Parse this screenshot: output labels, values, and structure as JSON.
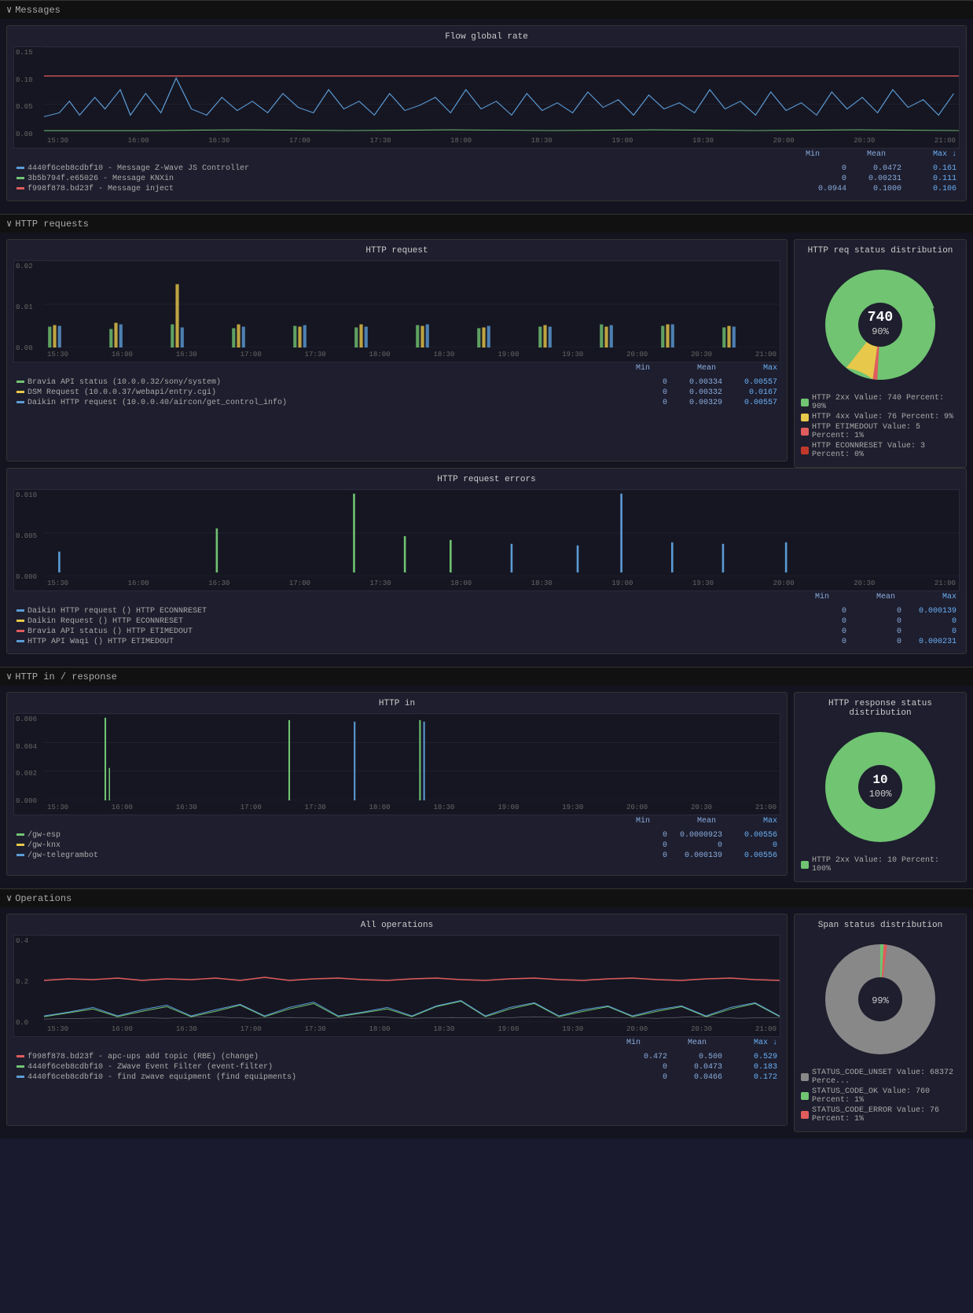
{
  "sections": {
    "messages": {
      "label": "Messages",
      "charts": {
        "flow_global_rate": {
          "title": "Flow global rate",
          "y_labels": [
            "0.15",
            "0.10",
            "0.05",
            "0.00"
          ],
          "x_labels": [
            "15:30",
            "16:00",
            "16:30",
            "17:00",
            "17:30",
            "18:00",
            "18:30",
            "19:00",
            "19:30",
            "20:00",
            "20:30",
            "21:00"
          ],
          "col_headers": [
            "Min",
            "Mean",
            "Max ↓"
          ],
          "legend": [
            {
              "color": "#5b9bd5",
              "label": "4440f6ceb8cdbf10 - Message Z-Wave JS Controller",
              "min": "0",
              "mean": "0.0472",
              "max": "0.161"
            },
            {
              "color": "#70c472",
              "label": "3b5b794f.e65026 - Message KNXin",
              "min": "0",
              "mean": "0.00231",
              "max": "0.111"
            },
            {
              "color": "#e05c5c",
              "label": "f998f878.bd23f - Message inject",
              "min": "0.0944",
              "mean": "0.1000",
              "max": "0.106"
            }
          ]
        }
      }
    },
    "http_requests": {
      "label": "HTTP requests",
      "charts": {
        "http_request": {
          "title": "HTTP request",
          "y_labels": [
            "0.02",
            "0.01",
            "0.00"
          ],
          "x_labels": [
            "15:30",
            "16:00",
            "16:30",
            "17:00",
            "17:30",
            "18:00",
            "18:30",
            "19:00",
            "19:30",
            "20:00",
            "20:30",
            "21:00"
          ],
          "col_headers": [
            "Min",
            "Mean",
            "Max"
          ],
          "legend": [
            {
              "color": "#70c472",
              "label": "Bravia API status (10.0.0.32/sony/system)",
              "min": "0",
              "mean": "0.00334",
              "max": "0.00557"
            },
            {
              "color": "#e8c84a",
              "label": "DSM Request (10.0.0.37/webapi/entry.cgi)",
              "min": "0",
              "mean": "0.00332",
              "max": "0.0167"
            },
            {
              "color": "#5b9bd5",
              "label": "Daikin HTTP request (10.0.0.40/aircon/get_control_info)",
              "min": "0",
              "mean": "0.00329",
              "max": "0.00557"
            }
          ]
        },
        "http_request_errors": {
          "title": "HTTP request errors",
          "y_labels": [
            "0.010",
            "0.005",
            "0.000"
          ],
          "x_labels": [
            "15:30",
            "16:00",
            "16:30",
            "17:00",
            "17:30",
            "18:00",
            "18:30",
            "19:00",
            "19:30",
            "20:00",
            "20:30",
            "21:00"
          ],
          "col_headers": [
            "Min",
            "Mean",
            "Max"
          ],
          "legend": [
            {
              "color": "#5b9bd5",
              "label": "Daikin HTTP request () HTTP ECONNRESET",
              "min": "0",
              "mean": "0",
              "max": "0.000139"
            },
            {
              "color": "#e8c84a",
              "label": "Daikin Request () HTTP ECONNRESET",
              "min": "0",
              "mean": "0",
              "max": "0"
            },
            {
              "color": "#e05c5c",
              "label": "Bravia API status () HTTP ETIMEDOUT",
              "min": "0",
              "mean": "0",
              "max": "0"
            },
            {
              "color": "#5b9bd5",
              "label": "HTTP API Waqi () HTTP ETIMEDOUT",
              "min": "0",
              "mean": "0",
              "max": "0.000231"
            }
          ]
        }
      },
      "pie": {
        "title": "HTTP req status distribution",
        "segments": [
          {
            "color": "#70c472",
            "label": "HTTP 2xx",
            "value": 740,
            "percent": "90%",
            "angle_start": 0,
            "angle_end": 324
          },
          {
            "color": "#e8c84a",
            "label": "HTTP 4xx",
            "value": 76,
            "percent": "9%",
            "angle_start": 324,
            "angle_end": 356
          },
          {
            "color": "#e05c5c",
            "label": "HTTP ETIMEDOUT",
            "value": 5,
            "percent": "1%",
            "angle_start": 356,
            "angle_end": 360
          },
          {
            "color": "#c0392b",
            "label": "HTTP ECONNRESET",
            "value": 3,
            "percent": "0%",
            "angle_start": 358,
            "angle_end": 360
          }
        ],
        "center_label": "740",
        "center_sub": "90%",
        "legend": [
          {
            "color": "#70c472",
            "text": "HTTP 2xx  Value: 740  Percent: 90%"
          },
          {
            "color": "#e8c84a",
            "text": "HTTP 4xx  Value: 76  Percent: 9%"
          },
          {
            "color": "#e05c5c",
            "text": "HTTP ETIMEDOUT  Value: 5  Percent: 1%"
          },
          {
            "color": "#c0392b",
            "text": "HTTP ECONNRESET  Value: 3  Percent: 0%"
          }
        ]
      }
    },
    "http_in_response": {
      "label": "HTTP in / response",
      "charts": {
        "http_in": {
          "title": "HTTP in",
          "y_labels": [
            "0.006",
            "0.004",
            "0.002",
            "0.000"
          ],
          "x_labels": [
            "15:30",
            "16:00",
            "16:30",
            "17:00",
            "17:30",
            "18:00",
            "18:30",
            "19:00",
            "19:30",
            "20:00",
            "20:30",
            "21:00"
          ],
          "col_headers": [
            "Min",
            "Mean",
            "Max"
          ],
          "legend": [
            {
              "color": "#70c472",
              "label": "/gw-esp",
              "min": "0",
              "mean": "0.0000923",
              "max": "0.00556"
            },
            {
              "color": "#e8c84a",
              "label": "/gw-knx",
              "min": "0",
              "mean": "0",
              "max": "0"
            },
            {
              "color": "#5b9bd5",
              "label": "/gw-telegrambot",
              "min": "0",
              "mean": "0.000139",
              "max": "0.00556"
            }
          ]
        }
      },
      "pie": {
        "title": "HTTP response status distribution",
        "segments": [
          {
            "color": "#70c472",
            "label": "HTTP 2xx",
            "value": 10,
            "percent": "100%"
          }
        ],
        "center_label": "10",
        "center_sub": "100%",
        "legend": [
          {
            "color": "#70c472",
            "text": "HTTP 2xx  Value: 10  Percent: 100%"
          }
        ]
      }
    },
    "operations": {
      "label": "Operations",
      "charts": {
        "all_operations": {
          "title": "All operations",
          "y_labels": [
            "0.4",
            "0.2",
            "0.0"
          ],
          "x_labels": [
            "15:30",
            "16:00",
            "16:30",
            "17:00",
            "17:30",
            "18:00",
            "18:30",
            "19:00",
            "19:30",
            "20:00",
            "20:30",
            "21:00"
          ],
          "col_headers": [
            "Min",
            "Mean",
            "Max ↓"
          ],
          "legend": [
            {
              "color": "#e05c5c",
              "label": "f998f878.bd23f - apc-ups add topic (RBE) (change)",
              "min": "0.472",
              "mean": "0.500",
              "max": "0.529"
            },
            {
              "color": "#70c472",
              "label": "4440f6ceb8cdbf10 - ZWave Event Filter (event-filter)",
              "min": "0",
              "mean": "0.0473",
              "max": "0.183"
            },
            {
              "color": "#5b9bd5",
              "label": "4440f6ceb8cdbf10 - find zwave equipment (find equipments)",
              "min": "0",
              "mean": "0.0466",
              "max": "0.172"
            }
          ]
        }
      },
      "pie": {
        "title": "Span status distribution",
        "segments": [
          {
            "color": "#888",
            "label": "STATUS_CODE_UNSET",
            "value": 68372,
            "percent": "99%"
          },
          {
            "color": "#70c472",
            "label": "STATUS_CODE_OK",
            "value": 760,
            "percent": "1%"
          },
          {
            "color": "#e05c5c",
            "label": "STATUS_CODE_ERROR",
            "value": 76,
            "percent": "1%"
          }
        ],
        "center_label": "",
        "center_sub": "99%",
        "legend": [
          {
            "color": "#888",
            "text": "STATUS_CODE_UNSET  Value: 68372  Perce..."
          },
          {
            "color": "#70c472",
            "text": "STATUS_CODE_OK  Value: 760  Percent: 1%"
          },
          {
            "color": "#e05c5c",
            "text": "STATUS_CODE_ERROR  Value: 76  Percent: 1%"
          }
        ]
      }
    }
  },
  "ui": {
    "chevron_down": "∨",
    "mean_label": "Mean"
  }
}
